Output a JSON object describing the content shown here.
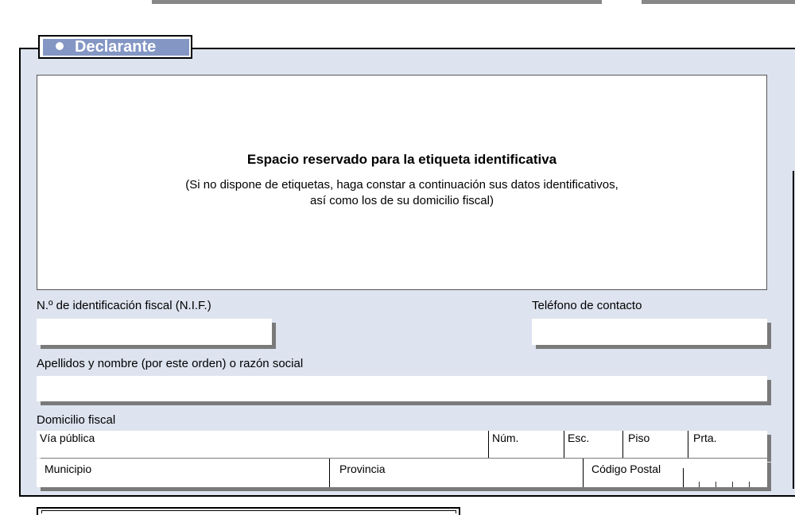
{
  "section": {
    "title": "Declarante"
  },
  "label_area": {
    "title": "Espacio reservado para la etiqueta identificativa",
    "note_line1": "(Si no dispone de etiquetas, haga constar a continuación sus datos identificativos,",
    "note_line2": "así como los de su domicilio fiscal)"
  },
  "fields": {
    "nif_label": "N.º de identificación fiscal (N.I.F.)",
    "nif_value": "",
    "phone_label": "Teléfono de contacto",
    "phone_value": "",
    "name_label": "Apellidos y nombre (por este orden) o razón social",
    "name_value": ""
  },
  "address": {
    "title": "Domicilio fiscal",
    "via_publica": "Vía pública",
    "numero": "Núm.",
    "escalera": "Esc.",
    "piso": "Piso",
    "puerta": "Prta.",
    "municipio": "Municipio",
    "provincia": "Provincia",
    "codigo_postal": "Código Postal"
  }
}
